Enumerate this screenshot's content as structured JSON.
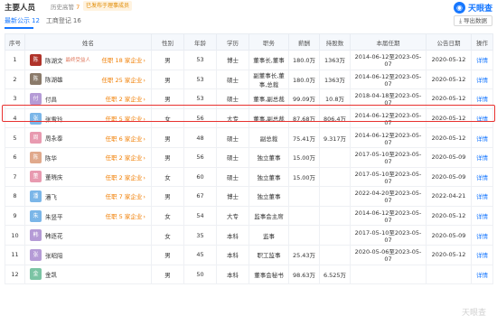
{
  "header": {
    "title": "主要人员",
    "history_label": "历史高管",
    "history_count": "7",
    "badge": "已发布于理事成员",
    "logo_text": "天眼查"
  },
  "tabs": [
    {
      "label": "最新公示",
      "count": "12",
      "active": true
    },
    {
      "label": "工商登记",
      "count": "16",
      "active": false
    }
  ],
  "export_label": "导出数据",
  "columns": [
    "序号",
    "姓名",
    "性别",
    "年龄",
    "学历",
    "职务",
    "薪酬",
    "持股数",
    "本届任期",
    "公告日期",
    "操作"
  ],
  "rows": [
    {
      "no": "1",
      "name": "陈湖文",
      "sub": "最终受益人",
      "serving": "任职 18 家企业",
      "gender": "男",
      "age": "53",
      "edu": "博士",
      "role": "董事长,董事",
      "pay": "180.0万",
      "shares": "1363万",
      "term": "2014-06-12至2023-05-07",
      "date": "2020-05-12",
      "action": "详情",
      "avatar_color": "#b0332a"
    },
    {
      "no": "2",
      "name": "陈湖雄",
      "sub": "",
      "serving": "任职 25 家企业",
      "gender": "男",
      "age": "53",
      "edu": "硕士",
      "role": "副董事长,董事,总裁",
      "pay": "180.0万",
      "shares": "1363万",
      "term": "2014-06-12至2023-05-07",
      "date": "2020-05-12",
      "action": "详情",
      "avatar_color": "#8a7a6a"
    },
    {
      "no": "3",
      "name": "付昌",
      "sub": "",
      "serving": "任职 2 家企业",
      "gender": "男",
      "age": "53",
      "edu": "硕士",
      "role": "董事,副总裁",
      "pay": "99.09万",
      "shares": "10.8万",
      "term": "2018-04-18至2023-05-07",
      "date": "2020-05-12",
      "action": "详情",
      "avatar_color": "#b59bd6"
    },
    {
      "no": "4",
      "name": "张雪玲",
      "sub": "",
      "serving": "任职 5 家企业",
      "gender": "女",
      "age": "56",
      "edu": "大专",
      "role": "董事,副总裁",
      "pay": "87.68万",
      "shares": "806.4万",
      "term": "2014-06-12至2023-05-07",
      "date": "2020-05-12",
      "action": "详情",
      "avatar_color": "#7bb6e8"
    },
    {
      "no": "5",
      "name": "周永泰",
      "sub": "",
      "serving": "任职 6 家企业",
      "gender": "男",
      "age": "48",
      "edu": "硕士",
      "role": "副总裁",
      "pay": "75.41万",
      "shares": "9.317万",
      "term": "2014-06-12至2023-05-07",
      "date": "2020-05-12",
      "action": "详情",
      "avatar_color": "#e89ab0"
    },
    {
      "no": "6",
      "name": "陈华",
      "sub": "",
      "serving": "任职 2 家企业",
      "gender": "男",
      "age": "56",
      "edu": "硕士",
      "role": "独立董事",
      "pay": "15.00万",
      "shares": "",
      "term": "2017-05-10至2023-05-07",
      "date": "2020-05-09",
      "action": "详情",
      "avatar_color": "#e0a98c"
    },
    {
      "no": "7",
      "name": "董晓庆",
      "sub": "",
      "serving": "任职 2 家企业",
      "gender": "女",
      "age": "60",
      "edu": "硕士",
      "role": "独立董事",
      "pay": "15.00万",
      "shares": "",
      "term": "2017-05-10至2023-05-07",
      "date": "2020-05-09",
      "action": "详情",
      "avatar_color": "#e89ab0"
    },
    {
      "no": "8",
      "name": "潘飞",
      "sub": "",
      "serving": "任职 7 家企业",
      "gender": "男",
      "age": "67",
      "edu": "博士",
      "role": "独立董事",
      "pay": "",
      "shares": "",
      "term": "2022-04-20至2023-05-07",
      "date": "2022-04-21",
      "action": "详情",
      "avatar_color": "#7bb6e8"
    },
    {
      "no": "9",
      "name": "朱竖平",
      "sub": "",
      "serving": "任职 5 家企业",
      "gender": "女",
      "age": "54",
      "edu": "大专",
      "role": "监事会主席",
      "pay": "",
      "shares": "",
      "term": "2014-06-12至2023-05-07",
      "date": "2020-05-12",
      "action": "详情",
      "avatar_color": "#7bb6e8"
    },
    {
      "no": "10",
      "name": "韩逐花",
      "sub": "",
      "serving": "",
      "gender": "女",
      "age": "35",
      "edu": "本科",
      "role": "监事",
      "pay": "",
      "shares": "",
      "term": "2017-05-10至2023-05-07",
      "date": "2020-05-09",
      "action": "详情",
      "avatar_color": "#b59bd6"
    },
    {
      "no": "11",
      "name": "张昭阳",
      "sub": "",
      "serving": "",
      "gender": "男",
      "age": "45",
      "edu": "本科",
      "role": "职工监事",
      "pay": "25.43万",
      "shares": "",
      "term": "2020-05-06至2023-05-07",
      "date": "2020-05-12",
      "action": "详情",
      "avatar_color": "#b59bd6"
    },
    {
      "no": "12",
      "name": "金凯",
      "sub": "",
      "serving": "",
      "gender": "男",
      "age": "50",
      "edu": "本科",
      "role": "董事会秘书",
      "pay": "98.63万",
      "shares": "6.525万",
      "term": "",
      "date": "",
      "action": "详情",
      "avatar_color": "#7bc4a4"
    }
  ],
  "watermark": "天眼查"
}
